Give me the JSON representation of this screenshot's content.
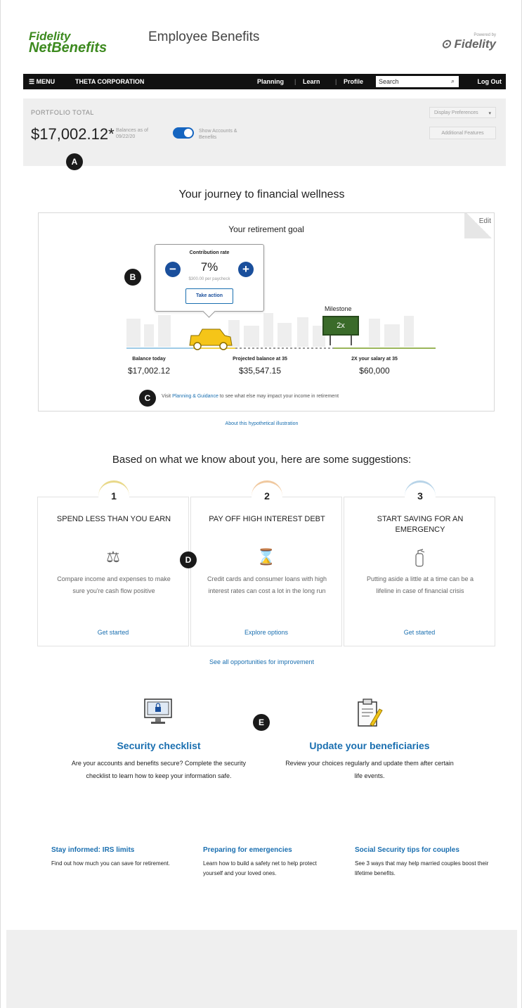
{
  "header": {
    "logo_line1": "Fidelity",
    "logo_line2": "NetBenefits",
    "title": "Employee Benefits",
    "powered_by": "Powered by",
    "powered_brand": "Fidelity"
  },
  "nav": {
    "menu": "MENU",
    "company": "THETA CORPORATION",
    "planning": "Planning",
    "learn": "Learn",
    "profile": "Profile",
    "search_placeholder": "Search",
    "logout": "Log Out"
  },
  "portfolio": {
    "label": "PORTFOLIO TOTAL",
    "amount": "$17,002.12*",
    "as_of": "Balances as of 09/22/20",
    "toggle_label": "Show Accounts & Benefits",
    "toggle_on": true,
    "display_preferences": "Display Preferences",
    "secondary_button": "Additional Features"
  },
  "markers": {
    "a": "A",
    "b": "B",
    "c": "C",
    "d": "D",
    "e": "E"
  },
  "journey": {
    "heading": "Your journey to financial wellness",
    "goal_title": "Your retirement goal",
    "edit": "Edit",
    "popover": {
      "title": "Contribution rate",
      "rate": "7%",
      "per_paycheck": "$300.00 per paycheck",
      "minus": "−",
      "plus": "+",
      "take_action": "Take action"
    },
    "milestone_label": "Milestone",
    "milestone_value": "2x",
    "stats": [
      {
        "label": "Balance today",
        "value": "$17,002.12"
      },
      {
        "label": "Projected balance at 35",
        "value": "$35,547.15"
      },
      {
        "label": "2X your salary at 35",
        "value": "$60,000"
      }
    ],
    "visit_prefix": "Visit",
    "visit_link": "Planning & Guidance",
    "visit_suffix": "to see what else may impact your income in retirement",
    "about_link": "About this hypothetical illustration"
  },
  "suggestions": {
    "heading": "Based on what we know about you, here are some suggestions:",
    "items": [
      {
        "number": "1",
        "title": "SPEND LESS THAN YOU EARN",
        "icon": "scale-icon",
        "glyph": "⚖",
        "description": "Compare income and expenses to make sure you're cash flow positive",
        "cta": "Get started",
        "ring_color": "#e9d98a"
      },
      {
        "number": "2",
        "title": "PAY OFF HIGH INTEREST DEBT",
        "icon": "hourglass-icon",
        "glyph": "⌛",
        "description": "Credit cards and consumer loans with high interest rates can cost a lot in the long run",
        "cta": "Explore options",
        "ring_color": "#f0c9a0"
      },
      {
        "number": "3",
        "title": "START SAVING FOR AN EMERGENCY",
        "icon": "fire-extinguisher-icon",
        "glyph": "🧯",
        "description": "Putting aside a little at a time can be a lifeline in case of financial crisis",
        "cta": "Get started",
        "ring_color": "#b8d4e8"
      }
    ],
    "see_all": "See all opportunities for improvement"
  },
  "features": [
    {
      "title": "Security checklist",
      "description": "Are your accounts and benefits secure? Complete the security checklist to learn how to keep your information safe.",
      "icon": "monitor-lock-icon"
    },
    {
      "title": "Update your beneficiaries",
      "description": "Review your choices regularly and update them after certain life events.",
      "icon": "clipboard-pencil-icon"
    }
  ],
  "info": [
    {
      "title": "Stay informed: IRS limits",
      "description": "Find out how much you can save for retirement."
    },
    {
      "title": "Preparing for emergencies",
      "description": "Learn how to build a safety net to help protect yourself and your loved ones."
    },
    {
      "title": "Social Security tips for couples",
      "description": "See 3 ways that may help married couples boost their lifetime benefits."
    }
  ],
  "colors": {
    "brand_green": "#3d8a1f",
    "link_blue": "#1a6fb0",
    "button_blue": "#1a4f9c",
    "nav_black": "#111111"
  }
}
